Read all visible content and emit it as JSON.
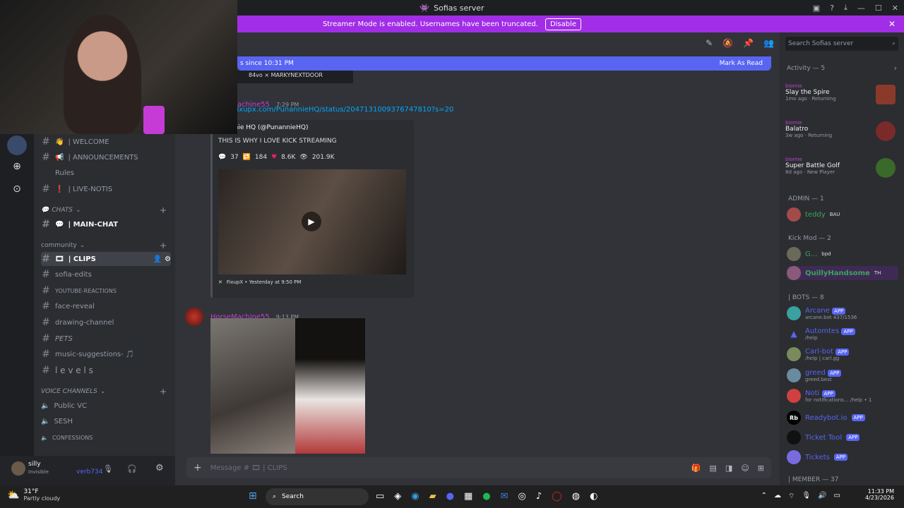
{
  "window": {
    "title": "Sofias server"
  },
  "banner": {
    "text": "Streamer Mode is enabled. Usernames have been truncated.",
    "disable": "Disable"
  },
  "guilds": {
    "items": [
      "avatar",
      "add-icon",
      "compass-icon"
    ]
  },
  "channels": [
    {
      "label": "| WELCOME",
      "prefix": "👋"
    },
    {
      "label": "| ANNOUNCEMENTS",
      "prefix": "📢"
    },
    {
      "label": "Rules",
      "prefix": ""
    },
    {
      "label": "| LIVE-NOTIS",
      "prefix": "❗"
    }
  ],
  "categories": {
    "chats": "CHATS",
    "community": "community",
    "voice": "VOICE CHANNELS"
  },
  "chat_channels": [
    {
      "label": "| MAIN-CHAT",
      "prefix": "💬"
    }
  ],
  "community_channels": [
    {
      "label": "| CLIPS",
      "prefix": "🎞"
    },
    {
      "label": "sofia-edits"
    },
    {
      "label": "YOUTUBE-REACTIONS"
    },
    {
      "label": "face-reveal"
    },
    {
      "label": "drawing-channel"
    },
    {
      "label": "PETS"
    },
    {
      "label": "music-suggestions- 🎵"
    },
    {
      "label": "l e v e l s"
    }
  ],
  "voice_channels": [
    {
      "label": "Public VC"
    },
    {
      "label": "SESH"
    },
    {
      "label": "CONFESSIONS"
    }
  ],
  "user": {
    "name": "silly",
    "status": "Invisible",
    "extra": "verb734"
  },
  "main": {
    "new_bar": "s since 10:31 PM",
    "mark_read": "Mark As Read",
    "message1": {
      "name": "achine55",
      "time": "7:29 PM",
      "link": "fixupx.com/PunannieHQ/status/2047131009376747810?s=20"
    },
    "embed": {
      "author": "unannie HQ (@PunannieHQ)",
      "text": "THIS IS WHY I LOVE KICK STREAMING",
      "stats": [
        "37",
        "184",
        "8.6K",
        "201.9K"
      ],
      "footer": "FixupX • Yesterday at 9:50 PM"
    },
    "message2": {
      "name": "HorseMachine55",
      "time": "9:13 PM"
    },
    "top_strip": "84vo × MARKYNEXTDOOR",
    "composer_placeholder": "Message # 🎞 | CLIPS"
  },
  "members": {
    "search": "Search Sofias server",
    "activity_header": "Activity — 5",
    "activities": [
      {
        "user": "biomie",
        "game": "Slay the Spire",
        "sub": "1mo ago · Returning"
      },
      {
        "user": "biomie",
        "game": "Balatro",
        "sub": "3w ago · Returning"
      },
      {
        "user": "biomie",
        "game": "Super Battle Golf",
        "sub": "8d ago · New Player"
      }
    ],
    "roles": [
      {
        "title": "ADMIN — 1",
        "members": [
          {
            "name": "teddy",
            "tag": "BAU",
            "color": "#3ba55c"
          }
        ]
      },
      {
        "title": "Kick Mod — 2",
        "members": [
          {
            "name": "G...",
            "tag": "bpd",
            "color": "#3ba55c"
          },
          {
            "name": "QuillyHandsome",
            "tag": "TH",
            "color": "#3ba55c"
          }
        ]
      },
      {
        "title": "| BOTS — 8",
        "members": [
          {
            "name": "Arcane",
            "sub": "arcane.bot 437/1536"
          },
          {
            "name": "Automtes",
            "sub": "/help"
          },
          {
            "name": "Carl-bot",
            "sub": "/help | carl.gg"
          },
          {
            "name": "greed",
            "sub": "greed.best"
          },
          {
            "name": "Noti",
            "sub": "for notifications... /help • 1"
          },
          {
            "name": "Readybot.io",
            "sub": ""
          },
          {
            "name": "Ticket Tool",
            "sub": ""
          },
          {
            "name": "Tickets",
            "sub": ""
          }
        ]
      },
      {
        "title": "| MEMBER — 37",
        "members": []
      }
    ],
    "app_label": "APP"
  },
  "taskbar": {
    "weather": "31°F",
    "weather_desc": "Partly cloudy",
    "search": "Search",
    "time": "11:33 PM",
    "date": "4/23/2026"
  }
}
